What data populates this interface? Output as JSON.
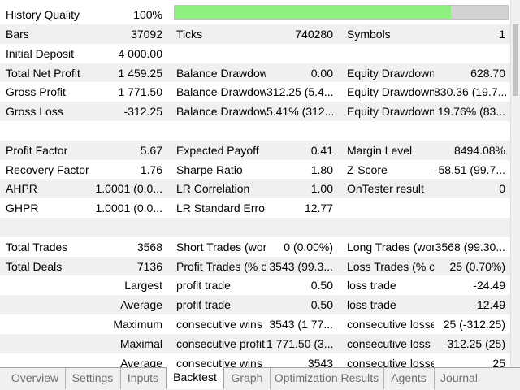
{
  "history_quality": {
    "label": "History Quality",
    "value": "100%",
    "fill_fraction": 0.83,
    "bar_color": "#8ef07e"
  },
  "rows": [
    {
      "c1l": "Bars",
      "c1v": "37092",
      "c2l": "Ticks",
      "c2v": "740280",
      "c3l": "Symbols",
      "c3v": "1"
    },
    {
      "c1l": "Initial Deposit",
      "c1v": "4 000.00",
      "c2l": "",
      "c2v": "",
      "c3l": "",
      "c3v": ""
    },
    {
      "c1l": "Total Net Profit",
      "c1v": "1 459.25",
      "c2l": "Balance Drawdow...",
      "c2v": "0.00",
      "c3l": "Equity Drawdown...",
      "c3v": "628.70"
    },
    {
      "c1l": "Gross Profit",
      "c1v": "1 771.50",
      "c2l": "Balance Drawdow...",
      "c2v": "312.25 (5.4...",
      "c3l": "Equity Drawdown...",
      "c3v": "830.36 (19.7..."
    },
    {
      "c1l": "Gross Loss",
      "c1v": "-312.25",
      "c2l": "Balance Drawdow...",
      "c2v": "5.41% (312...",
      "c3l": "Equity Drawdown...",
      "c3v": "19.76% (83..."
    },
    {
      "c1l": "",
      "c1v": "",
      "c2l": "",
      "c2v": "",
      "c3l": "",
      "c3v": ""
    },
    {
      "c1l": "Profit Factor",
      "c1v": "5.67",
      "c2l": "Expected Payoff",
      "c2v": "0.41",
      "c3l": "Margin Level",
      "c3v": "8494.08%"
    },
    {
      "c1l": "Recovery Factor",
      "c1v": "1.76",
      "c2l": "Sharpe Ratio",
      "c2v": "1.80",
      "c3l": "Z-Score",
      "c3v": "-58.51 (99.7..."
    },
    {
      "c1l": "AHPR",
      "c1v": "1.0001 (0.0...",
      "c2l": "LR Correlation",
      "c2v": "1.00",
      "c3l": "OnTester result",
      "c3v": "0"
    },
    {
      "c1l": "GHPR",
      "c1v": "1.0001 (0.0...",
      "c2l": "LR Standard Error",
      "c2v": "12.77",
      "c3l": "",
      "c3v": ""
    },
    {
      "c1l": "",
      "c1v": "",
      "c2l": "",
      "c2v": "",
      "c3l": "",
      "c3v": ""
    },
    {
      "c1l": "Total Trades",
      "c1v": "3568",
      "c2l": "Short Trades (won...",
      "c2v": "0 (0.00%)",
      "c3l": "Long Trades (won...",
      "c3v": "3568 (99.30..."
    },
    {
      "c1l": "Total Deals",
      "c1v": "7136",
      "c2l": "Profit Trades (% o...",
      "c2v": "3543 (99.3...",
      "c3l": "Loss Trades (% of ...",
      "c3v": "25 (0.70%)"
    },
    {
      "c1v": "Largest",
      "c2l": "profit trade",
      "c2v": "0.50",
      "c3l": "loss trade",
      "c3v": "-24.49"
    },
    {
      "c1v": "Average",
      "c2l": "profit trade",
      "c2v": "0.50",
      "c3l": "loss trade",
      "c3v": "-12.49"
    },
    {
      "c1v": "Maximum",
      "c2l": "consecutive wins (...",
      "c2v": "3543 (1 77...",
      "c3l": "consecutive losses...",
      "c3v": "25 (-312.25)"
    },
    {
      "c1v": "Maximal",
      "c2l": "consecutive profit...",
      "c2v": "1 771.50 (3...",
      "c3l": "consecutive loss (...",
      "c3v": "-312.25 (25)"
    },
    {
      "c1v": "Average",
      "c2l": "consecutive wins",
      "c2v": "3543",
      "c3l": "consecutive losses",
      "c3v": "25"
    }
  ],
  "tabs": [
    "Overview",
    "Settings",
    "Inputs",
    "Backtest",
    "Graph",
    "Optimization Results",
    "Agents",
    "Journal"
  ],
  "active_tab": "Backtest"
}
